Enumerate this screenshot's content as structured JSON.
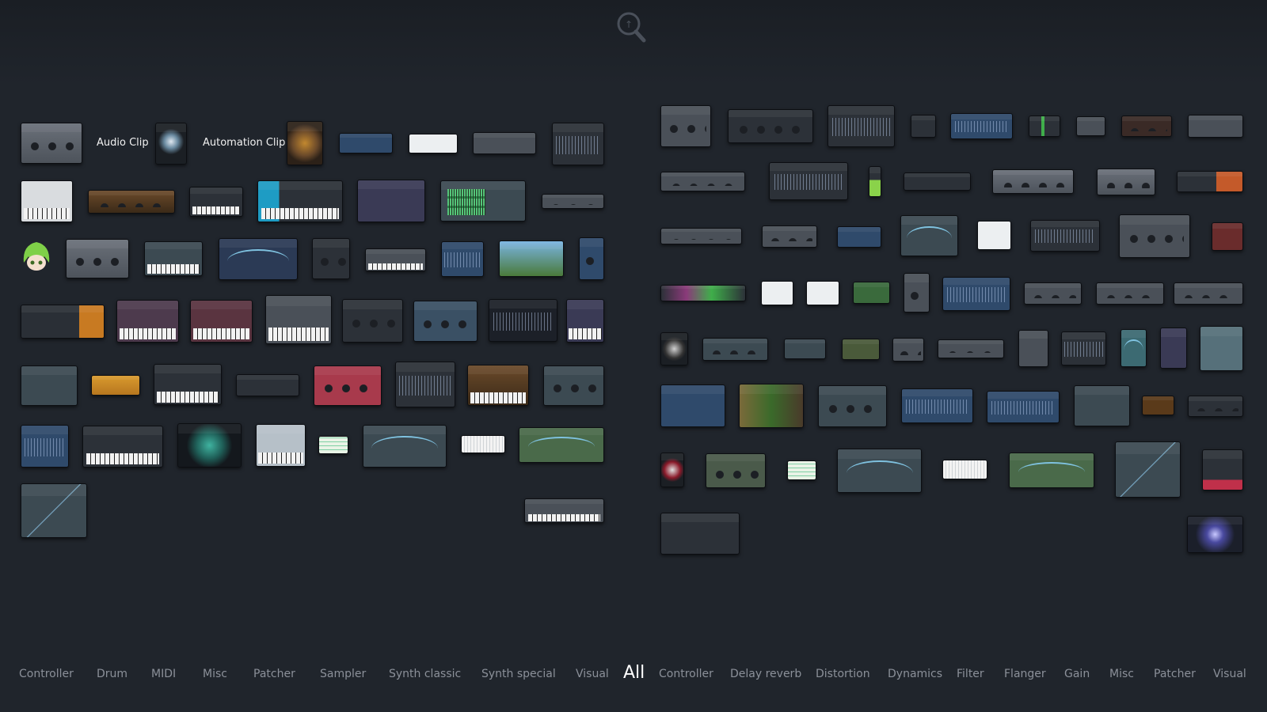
{
  "search": {
    "icon": "magnifier-icon"
  },
  "labels": {
    "audio_clip": "Audio Clip",
    "automation_clip": "Automation Clip"
  },
  "tabs": {
    "generators": [
      "Controller",
      "Drum",
      "MIDI",
      "Misc",
      "Patcher",
      "Sampler",
      "Synth classic",
      "Synth special",
      "Visual"
    ],
    "all": "All",
    "effects": [
      "Controller",
      "Delay reverb",
      "Distortion",
      "Dynamics",
      "Filter",
      "Flanger",
      "Gain",
      "Misc",
      "Patcher",
      "Visual"
    ]
  },
  "colors": {
    "background": "#1f232a",
    "tab_inactive": "#8b9099",
    "tab_active": "#ffffff"
  }
}
